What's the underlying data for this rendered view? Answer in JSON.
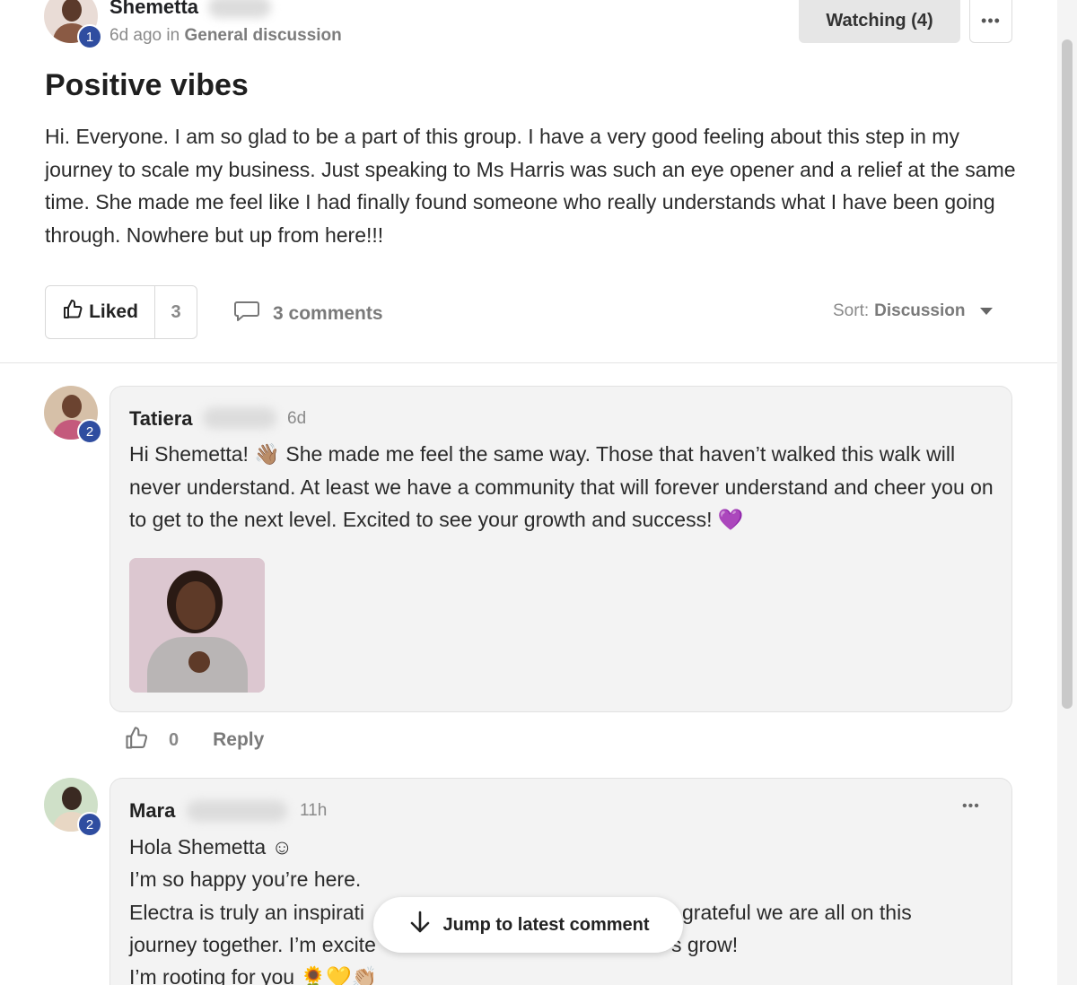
{
  "post": {
    "author_name": "Shemetta",
    "author_level": "1",
    "time_ago": "6d ago in",
    "category": "General discussion",
    "watching_label": "Watching (4)",
    "more_label": "•••",
    "title": "Positive vibes",
    "body": "Hi. Everyone. I am so glad to be a part of this group. I have a very good feeling about this step in my journey to scale my business. Just speaking to Ms Harris was such an eye opener and a relief at the same time. She made me feel like I had finally found someone who really understands what I have been going through. Nowhere but up from here!!!",
    "liked_label": "Liked",
    "like_count": "3",
    "comments_label": "3 comments",
    "sort_prefix": "Sort:",
    "sort_value": "Discussion"
  },
  "comments": [
    {
      "author_name": "Tatiera",
      "author_level": "2",
      "time": "6d",
      "body": "Hi Shemetta! 👋🏽 She made me feel the same way. Those that haven’t walked this walk will never understand. At least we have a community that will forever understand and cheer you on to get to the next level. Excited to see your growth and success! 💜",
      "like_count": "0",
      "reply_label": "Reply"
    },
    {
      "author_name": "Mara",
      "author_level": "2",
      "time": "11h",
      "more_label": "•••",
      "lines": [
        "Hola Shemetta ☺",
        "I’m so happy you’re here.",
        "Electra is truly an inspirati",
        "grateful we are all on this",
        "journey together. I’m excite",
        "s grow!",
        "I’m rooting for you 🌻💛👏🏼"
      ]
    }
  ],
  "jump_label": "Jump to latest comment",
  "colors": {
    "badge": "#2f4da0",
    "card_bg": "#f3f3f3",
    "watching_bg": "#e6e6e6"
  }
}
